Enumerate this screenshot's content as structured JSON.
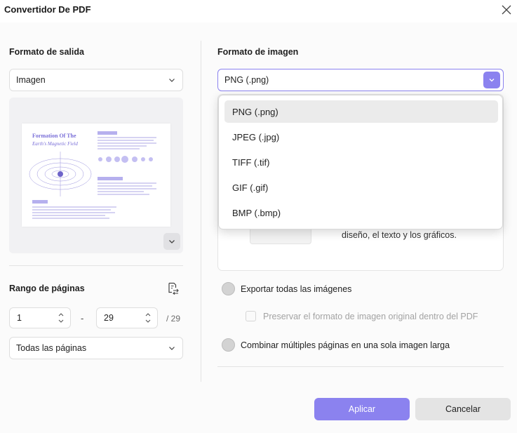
{
  "window": {
    "title": "Convertidor De PDF"
  },
  "left": {
    "output_format_heading": "Formato de salida",
    "output_format_value": "Imagen",
    "page_range_heading": "Rango de páginas",
    "range_from": "1",
    "range_separator": "-",
    "range_to": "29",
    "range_total": "/ 29",
    "range_mode_value": "Todas las páginas"
  },
  "preview": {
    "title_line1": "Formation Of The",
    "title_line2": "Earth's Magnetic Field"
  },
  "right": {
    "image_format_heading": "Formato de imagen",
    "image_format_value": "PNG (.png)",
    "options": [
      "PNG (.png)",
      "JPEG (.jpg)",
      "TIFF (.tif)",
      "GIF (.gif)",
      "BMP (.bmp)"
    ],
    "selected_option_index": 0,
    "info_text": "diseño, el texto y los gráficos.",
    "radio_export_all": "Exportar todas las imágenes",
    "checkbox_preserve": "Preservar el formato de imagen original dentro del PDF",
    "radio_combine": "Combinar múltiples páginas en una sola imagen larga"
  },
  "buttons": {
    "apply": "Aplicar",
    "cancel": "Cancelar"
  },
  "colors": {
    "accent": "#8b82ef",
    "selected_option_bg": "#ebebeb"
  },
  "icons": {
    "close": "close-icon",
    "chevron": "chevron-down-icon",
    "range_mode": "page-range-icon",
    "spin": "spinner-arrows-icon",
    "preview_toggle": "chevron-down-icon"
  }
}
